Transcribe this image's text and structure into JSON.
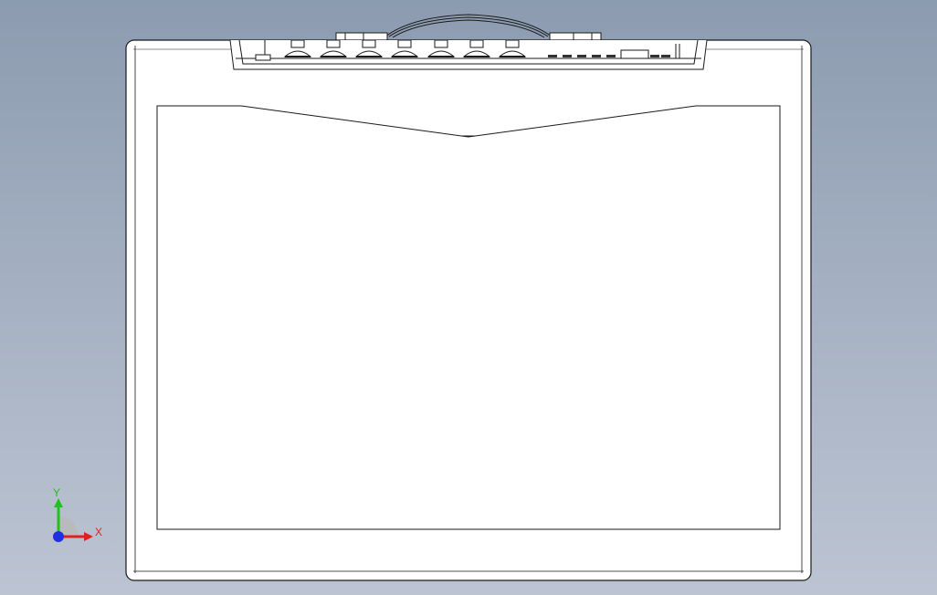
{
  "view": {
    "background_top": "#8c9bb0",
    "background_bottom": "#bcc4d2",
    "model_fill": "#ffffff",
    "model_edge": "#1a1a1a"
  },
  "triad": {
    "x_label": "X",
    "y_label": "Y",
    "x_color": "#e02020",
    "y_color": "#20c020",
    "z_color": "#2030e0"
  }
}
